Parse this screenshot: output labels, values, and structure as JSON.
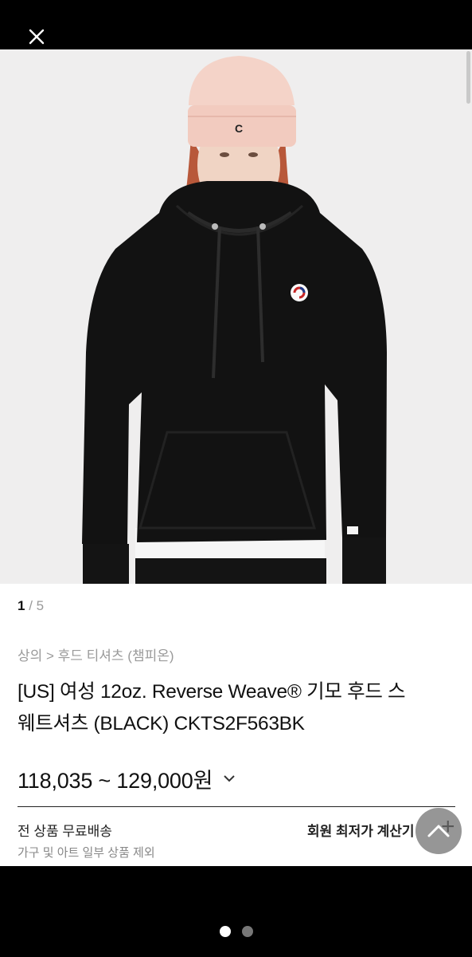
{
  "header": {
    "close_icon": "close-icon"
  },
  "gallery": {
    "current": "1",
    "separator": " / ",
    "total": "5",
    "image_alt": "model wearing black hooded sweatshirt and pink beanie"
  },
  "product": {
    "breadcrumb": "상의 > 후드 티셔츠 (챔피온)",
    "title_line1": "[US] 여성 12oz. Reverse Weave® 기모 후드 스",
    "title_line2": "웨트셔츠 (BLACK) CKTS2F563BK",
    "price_range": "118,035 ~ 129,000원"
  },
  "shipping": {
    "free_shipping": "전 상품 무료배송",
    "exception": "가구 및 아트 일부 상품 제외"
  },
  "member_calc": {
    "label": "회원 최저가 계산기",
    "plus": "+"
  },
  "colors": {
    "page_bg": "#000000",
    "photo_bg": "#efeeee",
    "hoodie": "#121212",
    "beanie": "#f2cbbf"
  }
}
